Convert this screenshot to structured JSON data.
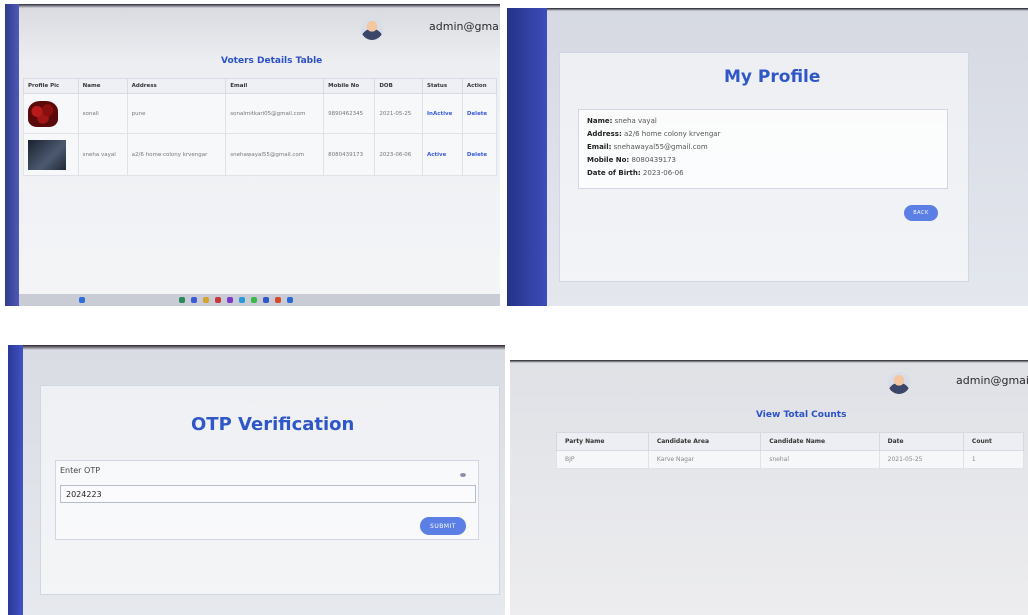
{
  "voters_panel": {
    "admin_email": "admin@gmail.c",
    "table_title": "Voters Details Table",
    "columns": [
      "Profile Pic",
      "Name",
      "Address",
      "Email",
      "Mobile No",
      "DOB",
      "Status",
      "Action"
    ],
    "rows": [
      {
        "pic": "roses",
        "name": "sonali",
        "address": "pune",
        "email": "sonalmitkari05@gmail.com",
        "mobile": "9890462345",
        "dob": "2021-05-25",
        "status": "InActive",
        "action": "Delete"
      },
      {
        "pic": "dark",
        "name": "sneha vayal",
        "address": "a2/6 home colony krvengar",
        "email": "snehawayal55@gmail.com",
        "mobile": "8080439173",
        "dob": "2023-06-06",
        "status": "Active",
        "action": "Delete"
      }
    ]
  },
  "profile_panel": {
    "title": "My Profile",
    "fields": [
      {
        "label": "Name:",
        "value": " sneha vayal"
      },
      {
        "label": "Address:",
        "value": " a2/6 home colony krvengar"
      },
      {
        "label": "Email:",
        "value": " snehawayal55@gmail.com"
      },
      {
        "label": "Mobile No:",
        "value": " 8080439173"
      },
      {
        "label": "Date of Birth:",
        "value": " 2023-06-06"
      }
    ],
    "back_label": "BACK"
  },
  "otp_panel": {
    "title": "OTP Verification",
    "input_label": "Enter OTP",
    "input_value": "2024223",
    "submit_label": "SUBMIT"
  },
  "counts_panel": {
    "admin_email": "admin@gmail.co",
    "table_title": "View Total Counts",
    "columns": [
      "Party Name",
      "Candidate Area",
      "Candidate Name",
      "Date",
      "Count"
    ],
    "rows": [
      {
        "party": "BJP",
        "area": "Karve Nagar",
        "candidate": "snehal",
        "date": "2021-05-25",
        "count": "1"
      }
    ]
  },
  "colors": {
    "accent_blue": "#2f57c8",
    "button_blue": "#5b7fe4",
    "sidebar_blue": "#3d4dbb"
  }
}
